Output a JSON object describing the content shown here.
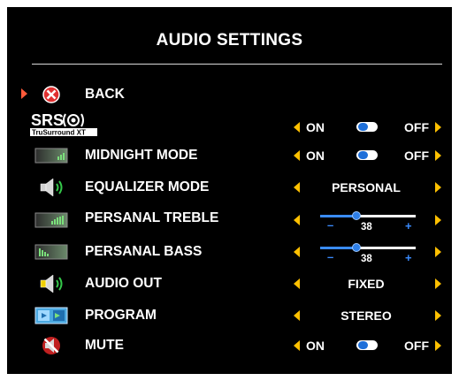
{
  "title": "AUDIO SETTINGS",
  "colors": {
    "background": "#000000",
    "text": "#ffffff",
    "arrow": "#ffc000",
    "accent": "#3a8cff",
    "selection_arrow": "#ff5a3a"
  },
  "menu": {
    "back": {
      "label": "BACK",
      "icon": "back-icon"
    },
    "srs": {
      "logo_text": "SRS",
      "logo_sub": "TruSurround XT",
      "on_label": "ON",
      "off_label": "OFF",
      "state": "off",
      "icon": "srs-logo"
    },
    "midnight": {
      "label": "MIDNIGHT MODE",
      "on_label": "ON",
      "off_label": "OFF",
      "state": "off",
      "icon": "midnight-mode-icon"
    },
    "equalizer": {
      "label": "EQUALIZER MODE",
      "value": "PERSONAL",
      "icon": "speaker-icon"
    },
    "treble": {
      "label": "PERSANAL TREBLE",
      "value": "38",
      "level": 0.38,
      "minus": "–",
      "plus": "+",
      "icon": "treble-icon"
    },
    "bass": {
      "label": "PERSANAL BASS",
      "value": "38",
      "level": 0.38,
      "minus": "–",
      "plus": "+",
      "icon": "bass-icon"
    },
    "audio_out": {
      "label": "AUDIO OUT",
      "value": "FIXED",
      "icon": "audio-out-icon"
    },
    "program": {
      "label": "PROGRAM",
      "value": "STEREO",
      "icon": "program-icon"
    },
    "mute": {
      "label": "MUTE",
      "on_label": "ON",
      "off_label": "OFF",
      "state": "off",
      "icon": "mute-icon"
    }
  }
}
